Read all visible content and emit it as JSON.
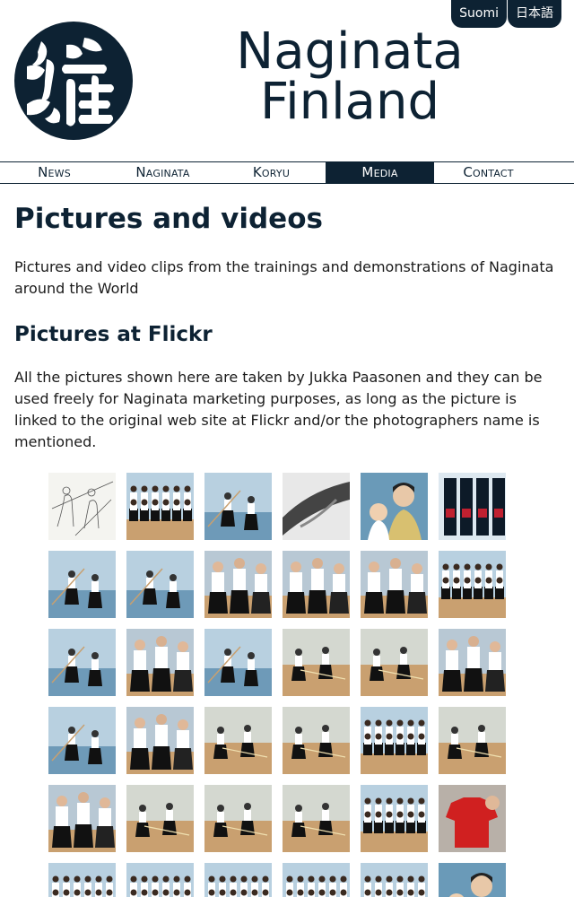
{
  "lang": {
    "items": [
      {
        "label": "Suomi"
      },
      {
        "label": "日本語"
      }
    ]
  },
  "header": {
    "title_line1": "Naginata",
    "title_line2": "Finland"
  },
  "nav": {
    "items": [
      {
        "label": "News"
      },
      {
        "label": "Naginata"
      },
      {
        "label": "Koryu"
      },
      {
        "label": "Media",
        "active": true
      },
      {
        "label": "Contact"
      }
    ]
  },
  "content": {
    "title": "Pictures and videos",
    "intro": "Pictures and video clips from the trainings and demonstrations of Naginata around the World",
    "flickr_title": "Pictures at Flickr",
    "flickr_text": "All the pictures shown here are taken by Jukka Paasonen and they can be used freely for Naginata marketing purposes, as long as the picture is linked to the original web site at Flickr and/or the photographers name is mentioned."
  },
  "gallery": {
    "thumbs": [
      {
        "icon": "sketch"
      },
      {
        "icon": "group"
      },
      {
        "icon": "gym"
      },
      {
        "icon": "close"
      },
      {
        "icon": "portrait"
      },
      {
        "icon": "armor"
      },
      {
        "icon": "gym"
      },
      {
        "icon": "gym"
      },
      {
        "icon": "people"
      },
      {
        "icon": "people"
      },
      {
        "icon": "people"
      },
      {
        "icon": "group"
      },
      {
        "icon": "gym"
      },
      {
        "icon": "people"
      },
      {
        "icon": "gym"
      },
      {
        "icon": "floor"
      },
      {
        "icon": "floor"
      },
      {
        "icon": "people"
      },
      {
        "icon": "gym"
      },
      {
        "icon": "people"
      },
      {
        "icon": "floor"
      },
      {
        "icon": "floor"
      },
      {
        "icon": "group"
      },
      {
        "icon": "floor"
      },
      {
        "icon": "people"
      },
      {
        "icon": "floor"
      },
      {
        "icon": "floor"
      },
      {
        "icon": "floor"
      },
      {
        "icon": "group"
      },
      {
        "icon": "shirt"
      },
      {
        "icon": "group"
      },
      {
        "icon": "group"
      },
      {
        "icon": "group"
      },
      {
        "icon": "group"
      },
      {
        "icon": "group"
      },
      {
        "icon": "portrait"
      }
    ]
  },
  "colors": {
    "brand": "#0d2233",
    "floor": "#c9a070",
    "wall": "#b8d0e0"
  }
}
